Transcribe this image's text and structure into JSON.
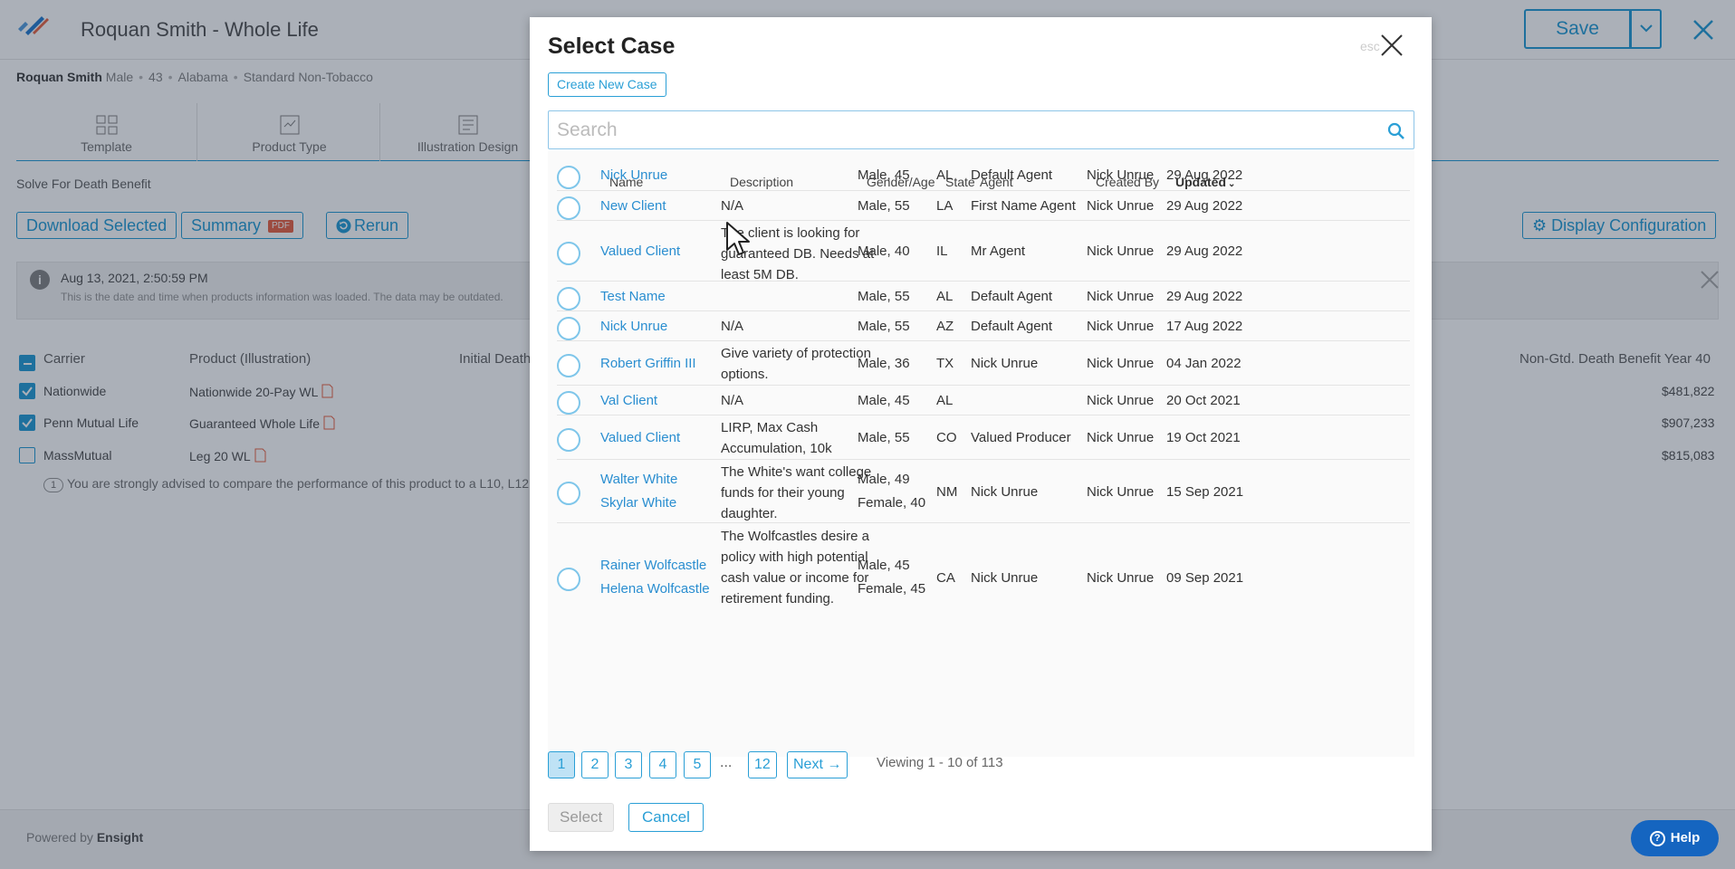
{
  "app": {
    "title": "Roquan Smith - Whole Life",
    "save_label": "Save",
    "profile": {
      "name": "Roquan Smith",
      "gender": "Male",
      "age": "43",
      "state": "Alabama",
      "health": "Standard Non-Tobacco"
    },
    "tabs": [
      {
        "label": "Template",
        "icon": "template-grid-icon"
      },
      {
        "label": "Product Type",
        "icon": "product-type-icon"
      },
      {
        "label": "Illustration Design",
        "icon": "illustration-design-icon"
      }
    ],
    "solve_for": "Solve For Death Benefit",
    "toolbar": {
      "download_selected": "Download Selected",
      "summary": "Summary",
      "pdf_badge": "PDF",
      "rerun": "Rerun",
      "display_configuration": "Display Configuration"
    },
    "info": {
      "date": "Aug 13, 2021, 2:50:59 PM",
      "note": "This is the date and time when products information was loaded. The data may be outdated."
    },
    "table": {
      "headers": {
        "carrier": "Carrier",
        "product": "Product (Illustration)",
        "initial": "Initial Death",
        "nongtd": "Non-Gtd. Death Benefit Year 40"
      },
      "rows": [
        {
          "checked": true,
          "carrier": "Nationwide",
          "product": "Nationwide 20-Pay WL",
          "value": "$481,822"
        },
        {
          "checked": true,
          "carrier": "Penn Mutual Life",
          "product": "Guaranteed Whole Life",
          "value": "$907,233"
        },
        {
          "checked": false,
          "carrier": "MassMutual",
          "product": "Leg 20 WL",
          "value": "$815,083"
        }
      ]
    },
    "advise": {
      "num": "1",
      "text": "You are strongly advised to compare the performance of this product to a L10, L12 o"
    },
    "footer": {
      "powered_prefix": "Powered by",
      "powered_brand": "Ensight"
    },
    "help_label": "Help"
  },
  "modal": {
    "title": "Select Case",
    "esc_label": "esc",
    "create_new_case": "Create New Case",
    "search_placeholder": "Search",
    "columns": {
      "name": "Name",
      "description": "Description",
      "gender_age": "Gender/Age",
      "state": "State",
      "agent": "Agent",
      "created_by": "Created By",
      "updated": "Updated",
      "updated_sort": "descending"
    },
    "rows": [
      {
        "names": [
          "Nick Unrue"
        ],
        "description": "",
        "gender_age": [
          "Male, 45"
        ],
        "state": "AL",
        "agent": "Default Agent",
        "created_by": "Nick Unrue",
        "updated": "29 Aug 2022"
      },
      {
        "names": [
          "New Client"
        ],
        "description": "N/A",
        "gender_age": [
          "Male, 55"
        ],
        "state": "LA",
        "agent": "First Name Agent",
        "created_by": "Nick Unrue",
        "updated": "29 Aug 2022"
      },
      {
        "names": [
          "Valued Client"
        ],
        "description": "The client is looking for guaranteed DB. Needs at least 5M DB.",
        "gender_age": [
          "Male, 40"
        ],
        "state": "IL",
        "agent": "Mr Agent",
        "created_by": "Nick Unrue",
        "updated": "29 Aug 2022"
      },
      {
        "names": [
          "Test Name"
        ],
        "description": "",
        "gender_age": [
          "Male, 55"
        ],
        "state": "AL",
        "agent": "Default Agent",
        "created_by": "Nick Unrue",
        "updated": "29 Aug 2022"
      },
      {
        "names": [
          "Nick Unrue"
        ],
        "description": "N/A",
        "gender_age": [
          "Male, 55"
        ],
        "state": "AZ",
        "agent": "Default Agent",
        "created_by": "Nick Unrue",
        "updated": "17 Aug 2022"
      },
      {
        "names": [
          "Robert Griffin III"
        ],
        "description": "Give variety of protection options.",
        "gender_age": [
          "Male, 36"
        ],
        "state": "TX",
        "agent": "Nick Unrue",
        "created_by": "Nick Unrue",
        "updated": "04 Jan 2022"
      },
      {
        "names": [
          "Val Client"
        ],
        "description": "N/A",
        "gender_age": [
          "Male, 45"
        ],
        "state": "AL",
        "agent": "",
        "created_by": "Nick Unrue",
        "updated": "20 Oct 2021"
      },
      {
        "names": [
          "Valued Client"
        ],
        "description": "LIRP, Max Cash Accumulation, 10k",
        "gender_age": [
          "Male, 55"
        ],
        "state": "CO",
        "agent": "Valued Producer",
        "created_by": "Nick Unrue",
        "updated": "19 Oct 2021"
      },
      {
        "names": [
          "Walter White",
          "Skylar White"
        ],
        "description": "The White's want college funds for their young daughter.",
        "gender_age": [
          "Male, 49",
          "Female, 40"
        ],
        "state": "NM",
        "agent": "Nick Unrue",
        "created_by": "Nick Unrue",
        "updated": "15 Sep 2021"
      },
      {
        "names": [
          "Rainer Wolfcastle",
          "Helena Wolfcastle"
        ],
        "description": "The Wolfcastles desire a policy with high potential cash value or income for retirement funding.",
        "gender_age": [
          "Male, 45",
          "Female, 45"
        ],
        "state": "CA",
        "agent": "Nick Unrue",
        "created_by": "Nick Unrue",
        "updated": "09 Sep 2021"
      }
    ],
    "pagination": {
      "pages": [
        "1",
        "2",
        "3",
        "4",
        "5"
      ],
      "ellipsis": "...",
      "last_page": "12",
      "current": "1",
      "next_label": "Next →",
      "viewing": "Viewing 1 - 10 of 113"
    },
    "select_label": "Select",
    "cancel_label": "Cancel"
  },
  "colors": {
    "accent": "#2a9fd6",
    "link": "#2a8ed0",
    "help": "#1565c0",
    "pdf": "#e8674a"
  }
}
